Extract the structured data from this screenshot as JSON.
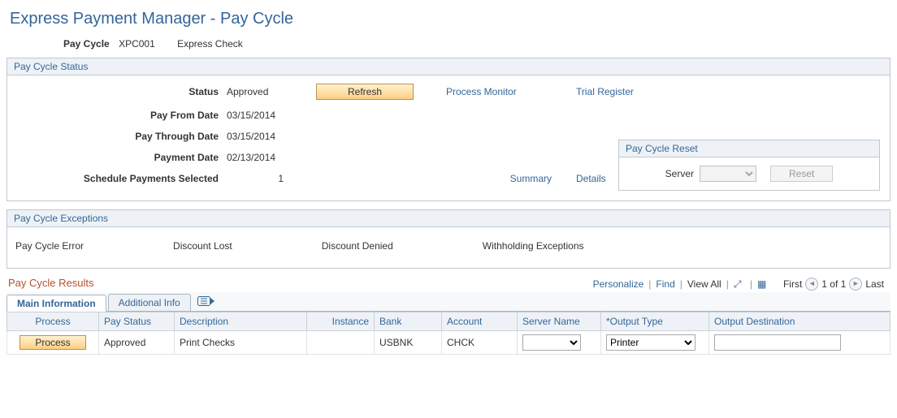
{
  "page": {
    "title": "Express Payment Manager - Pay Cycle"
  },
  "header": {
    "pay_cycle_label": "Pay Cycle",
    "pay_cycle_value": "XPC001",
    "pay_cycle_desc": "Express Check"
  },
  "status_box": {
    "title": "Pay Cycle Status",
    "labels": {
      "status": "Status",
      "pay_from": "Pay From Date",
      "pay_through": "Pay Through Date",
      "payment_date": "Payment Date",
      "sched_sel": "Schedule Payments Selected"
    },
    "values": {
      "status": "Approved",
      "pay_from": "03/15/2014",
      "pay_through": "03/15/2014",
      "payment_date": "02/13/2014",
      "sched_sel": "1"
    },
    "buttons": {
      "refresh": "Refresh"
    },
    "links": {
      "process_monitor": "Process Monitor",
      "trial_register": "Trial Register",
      "summary": "Summary",
      "details": "Details"
    },
    "reset": {
      "title": "Pay Cycle Reset",
      "server_label": "Server",
      "server_value": "",
      "reset_btn": "Reset"
    }
  },
  "exceptions_box": {
    "title": "Pay Cycle Exceptions",
    "items": {
      "error": "Pay Cycle Error",
      "discount_lost": "Discount Lost",
      "discount_denied": "Discount Denied",
      "withholding": "Withholding Exceptions"
    }
  },
  "results": {
    "title": "Pay Cycle Results",
    "toolbar": {
      "personalize": "Personalize",
      "find": "Find",
      "view_all": "View All",
      "first": "First",
      "counter": "1 of 1",
      "last": "Last"
    },
    "tabs": {
      "main": "Main Information",
      "additional": "Additional Info"
    },
    "columns": {
      "process": "Process",
      "pay_status": "Pay Status",
      "description": "Description",
      "instance": "Instance",
      "bank": "Bank",
      "account": "Account",
      "server_name": "Server Name",
      "output_type": "*Output Type",
      "output_dest": "Output Destination"
    },
    "row": {
      "process_btn": "Process",
      "pay_status": "Approved",
      "description": "Print Checks",
      "instance": "",
      "bank": "USBNK",
      "account": "CHCK",
      "server_name": "",
      "output_type": "Printer",
      "output_dest": ""
    }
  }
}
